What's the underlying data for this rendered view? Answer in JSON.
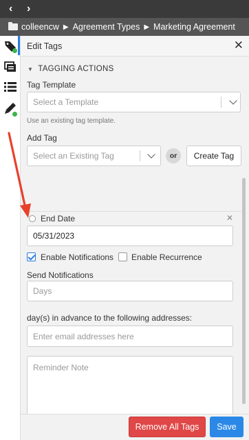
{
  "nav": {
    "back_icon": "chevron-left-icon",
    "forward_icon": "chevron-right-icon",
    "back_glyph": "‹",
    "forward_glyph": "›"
  },
  "breadcrumb": {
    "items": [
      "colleencw",
      "Agreement Types",
      "Marketing Agreement"
    ]
  },
  "panel": {
    "title": "Edit Tags",
    "section": "TAGGING ACTIONS",
    "tag_template": {
      "label": "Tag Template",
      "placeholder": "Select a Template",
      "hint": "Use an existing tag template."
    },
    "add_tag": {
      "label": "Add Tag",
      "placeholder": "Select an Existing Tag",
      "or": "or",
      "create_label": "Create Tag"
    },
    "end_date": {
      "label": "End Date",
      "value": "05/31/2023"
    },
    "enable_notifications": {
      "label": "Enable Notifications",
      "checked": true
    },
    "enable_recurrence": {
      "label": "Enable Recurrence",
      "checked": false
    },
    "send_notifications": {
      "label": "Send Notifications",
      "days_placeholder": "Days"
    },
    "advance_text": "day(s) in advance to the following addresses:",
    "email_placeholder": "Enter email addresses here",
    "reminder_placeholder": "Reminder Note"
  },
  "footer": {
    "remove_all": "Remove All Tags",
    "save": "Save"
  },
  "colors": {
    "accent": "#2a7be0",
    "danger": "#e04747",
    "primary": "#2b88e6",
    "status_dot": "#39b54a",
    "annotation_arrow": "#e8412b"
  }
}
